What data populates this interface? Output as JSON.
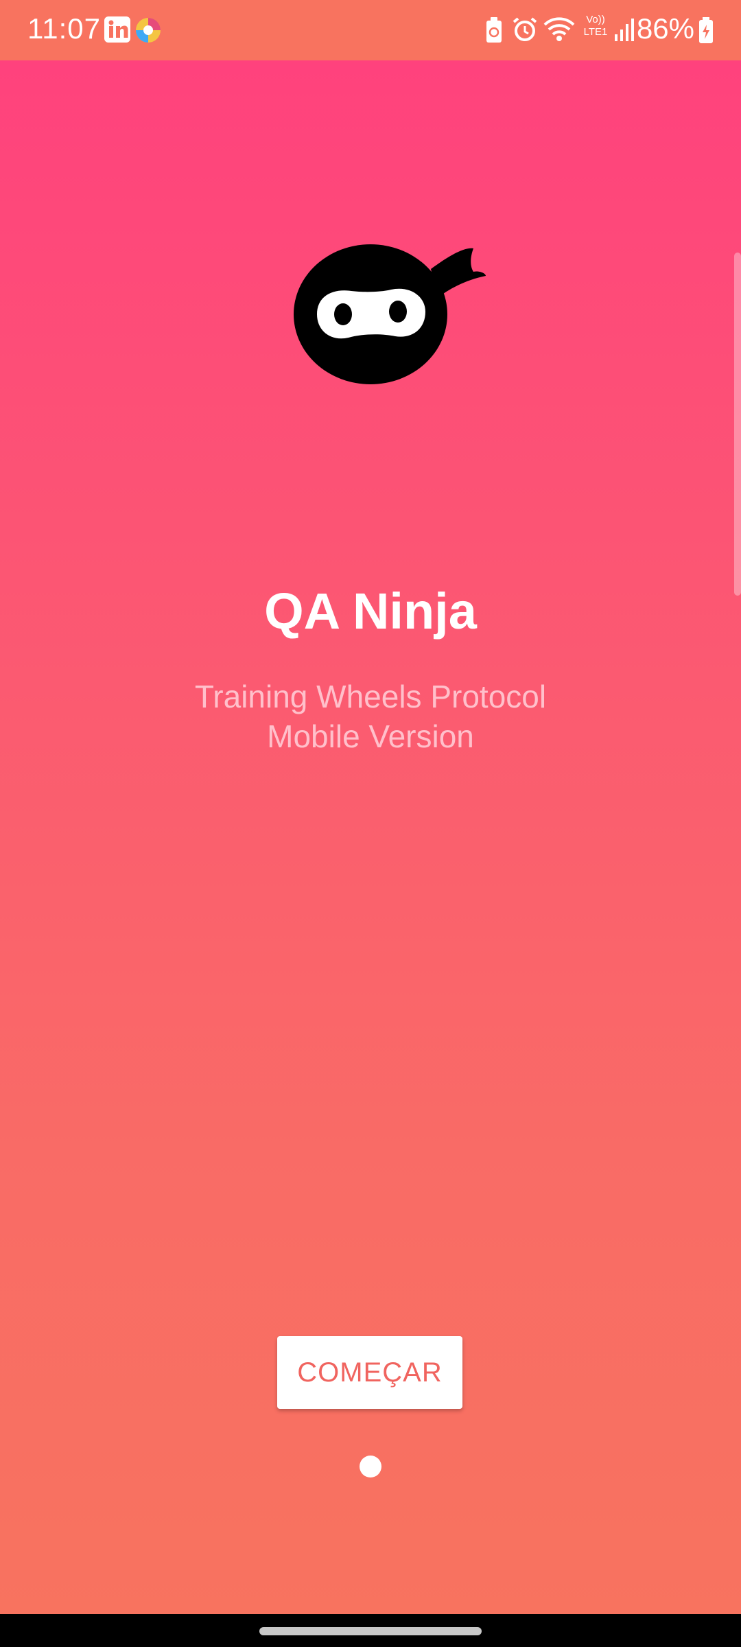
{
  "status_bar": {
    "time": "11:07",
    "battery_percent": "86%",
    "network_label": "Vo)) LTE1",
    "icons": [
      "linkedin-icon",
      "browser-icon",
      "battery-saver-icon",
      "alarm-icon",
      "wifi-icon",
      "lte-icon",
      "signal-icon",
      "battery-charging-icon"
    ]
  },
  "app": {
    "title": "QA Ninja",
    "subtitle_line1": "Training Wheels Protocol",
    "subtitle_line2": "Mobile Version",
    "start_button_label": "COMEÇAR",
    "page_indicator": {
      "count": 1,
      "active_index": 0
    }
  },
  "colors": {
    "gradient_top": "#ff427d",
    "gradient_bottom": "#f8735f",
    "button_text": "#f0645f",
    "subtitle": "#ffc0cb"
  }
}
